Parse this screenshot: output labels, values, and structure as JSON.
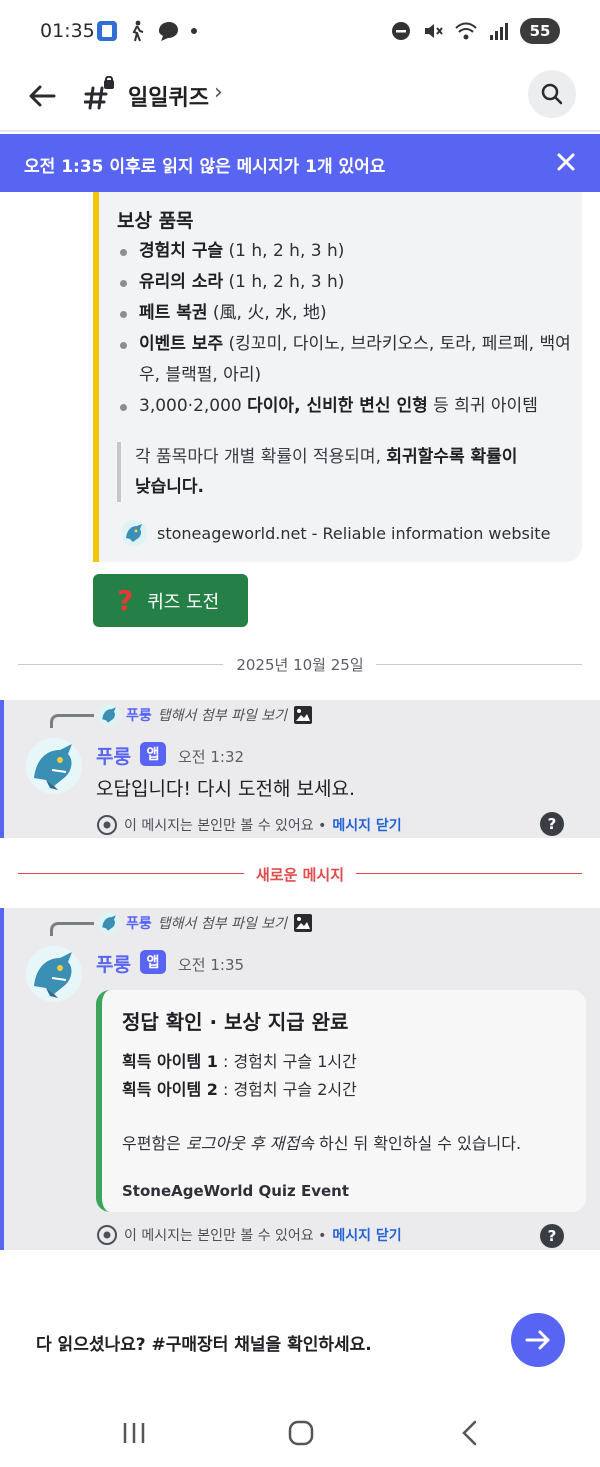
{
  "status_bar": {
    "time": "01:35",
    "battery": "55"
  },
  "header": {
    "channel_name": "일일퀴즈",
    "chevron": "›"
  },
  "banner": {
    "text": "오전 1:35 이후로 읽지 않은 메시지가 1개 있어요"
  },
  "embed_rewards": {
    "field_title": "보상 품목",
    "items": [
      {
        "bold": "경험치 구슬",
        "rest": " (1 h, 2 h, 3 h)"
      },
      {
        "bold": "유리의 소라",
        "rest": " (1 h, 2 h, 3 h)"
      },
      {
        "bold": "페트 복권",
        "rest": " (風, 火, 水, 地)"
      },
      {
        "bold": "이벤트 보주",
        "rest": " (킹꼬미, 다이노, 브라키오스, 토라, 페르페, 백여우, 블랙펄, 아리)"
      },
      {
        "pre": "3,000·2,000 ",
        "bold": "다이아, 신비한 변신 인형",
        "rest": " 등 희귀 아이템"
      }
    ],
    "quote_plain": "각 품목마다 개별 확률이 적용되며, ",
    "quote_bold": "회귀할수록 확률이 낮습니다.",
    "footer": "stoneageworld.net - Reliable information website"
  },
  "quiz_button": {
    "label": "퀴즈 도전",
    "icon": "?"
  },
  "date_divider": "2025년 10월 25일",
  "message1": {
    "reply_name": "푸룽",
    "reply_text": "탭해서 첨부 파일 보기",
    "username": "푸룽",
    "badge": "앱",
    "time": "오전 1:32",
    "text": "오답입니다! 다시 도전해 보세요.",
    "ephemeral": "이 메시지는 본인만 볼 수 있어요 •",
    "dismiss": "메시지 닫기",
    "help": "?"
  },
  "new_divider": "새로운 메시지",
  "message2": {
    "reply_name": "푸룽",
    "reply_text": "탭해서 첨부 파일 보기",
    "username": "푸룽",
    "badge": "앱",
    "time": "오전 1:35",
    "embed": {
      "title": "정답 확인 · 보상 지급 완료",
      "item1_label": "획득 아이템 1",
      "item1_value": " : 경험치 구슬 1시간",
      "item2_label": "획득 아이템 2",
      "item2_value": " : 경험치 구슬 2시간",
      "note_pre": "우편함은 ",
      "note_italic": "로그아웃 후 재접속",
      "note_post": " 하신 뒤 확인하실 수 있습니다.",
      "footer": "StoneAgeWorld Quiz Event"
    },
    "ephemeral": "이 메시지는 본인만 볼 수 있어요 •",
    "dismiss": "메시지 닫기",
    "help": "?"
  },
  "bottom_prompt": "다 읽으셨나요? #구매장터 채널을 확인하세요.",
  "colors": {
    "blurple": "#5865f2",
    "green": "#248046",
    "gold": "#f2c50b",
    "embed_green": "#3ba55c",
    "red": "#e24b4b"
  },
  "icons": [
    "back-arrow-icon",
    "hash-lock-icon",
    "search-icon",
    "close-icon",
    "eye-icon",
    "image-icon",
    "send-arrow-icon",
    "recents-icon",
    "home-icon",
    "back-nav-icon"
  ]
}
